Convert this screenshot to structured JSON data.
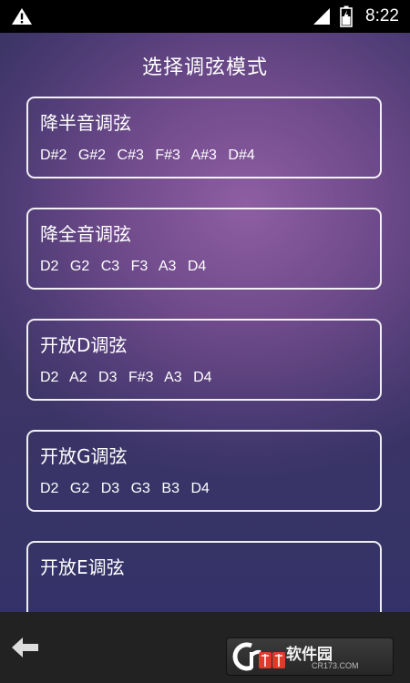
{
  "status_bar": {
    "time": "8:22",
    "icons": [
      "warning-icon",
      "signal-icon",
      "battery-icon"
    ]
  },
  "header": {
    "title": "选择调弦模式"
  },
  "tunings": [
    {
      "name": "降半音调弦",
      "notes": [
        "D#2",
        "G#2",
        "C#3",
        "F#3",
        "A#3",
        "D#4"
      ]
    },
    {
      "name": "降全音调弦",
      "notes": [
        "D2",
        "G2",
        "C3",
        "F3",
        "A3",
        "D4"
      ]
    },
    {
      "name": "开放D调弦",
      "notes": [
        "D2",
        "A2",
        "D3",
        "F#3",
        "A3",
        "D4"
      ]
    },
    {
      "name": "开放G调弦",
      "notes": [
        "D2",
        "G2",
        "D3",
        "G3",
        "B3",
        "D4"
      ]
    },
    {
      "name": "开放E调弦",
      "notes": []
    }
  ],
  "bottom_bar": {
    "back_icon": "back-arrow-icon",
    "watermark": {
      "text": "软件园",
      "url": "CR173.COM"
    }
  },
  "colors": {
    "background_light": "#8e5ea3",
    "background_dark": "#3d3566",
    "status_bar": "#000000",
    "bottom_bar": "#222222",
    "card_border": "#ffffff",
    "text": "#ffffff",
    "watermark_red": "#e03a2a"
  }
}
